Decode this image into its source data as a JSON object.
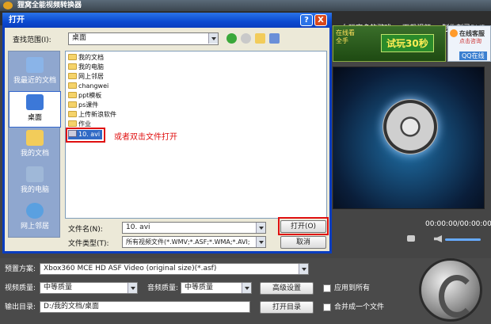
{
  "app": {
    "title": "狸窝全能视频转换器",
    "links": [
      "女玩家多的游戏",
      "下载视频",
      "制作刻录DVD"
    ],
    "ad": {
      "left_text": "在线看\n全手",
      "button": "试玩30秒"
    },
    "qq": {
      "line1": "在线客服",
      "line2": "点击咨询",
      "line3": "QQ在线"
    },
    "time": "00:00:00/00:00:00"
  },
  "dialog": {
    "title": "打开",
    "help_btn": "?",
    "close_btn": "X",
    "lookin_label": "查找范围(I):",
    "lookin_value": "桌面",
    "places": [
      "我最近的文档",
      "桌面",
      "我的文档",
      "我的电脑",
      "网上邻居"
    ],
    "files": [
      {
        "name": "我的文档",
        "type": "folder"
      },
      {
        "name": "我的电脑",
        "type": "folder"
      },
      {
        "name": "网上邻居",
        "type": "folder"
      },
      {
        "name": "changwei",
        "type": "folder"
      },
      {
        "name": "ppt模板",
        "type": "folder"
      },
      {
        "name": "ps课件",
        "type": "folder"
      },
      {
        "name": "上传新浪软件",
        "type": "folder"
      },
      {
        "name": "作业",
        "type": "folder"
      },
      {
        "name": "10. avi",
        "type": "video",
        "selected": true
      }
    ],
    "hint": "或者双击文件打开",
    "filename_label": "文件名(N):",
    "filename_value": "10. avi",
    "filetype_label": "文件类型(T):",
    "filetype_value": "所有视频文件(*.WMV;*.ASF;*.WMA;*.AVI;",
    "open_btn": "打开(O)",
    "cancel_btn": "取消"
  },
  "bottom": {
    "preset_label": "预置方案:",
    "preset_value": "Xbox360 MCE HD ASF Video (original size)(*.asf)",
    "vq_label": "视频质量:",
    "vq_value": "中等质量",
    "aq_label": "音频质量:",
    "aq_value": "中等质量",
    "advanced_btn": "高级设置",
    "apply_all": "应用到所有",
    "output_label": "输出目录:",
    "output_value": "D:/我的文档/桌面",
    "open_dir_btn": "打开目录",
    "merge": "合并成一个文件"
  }
}
